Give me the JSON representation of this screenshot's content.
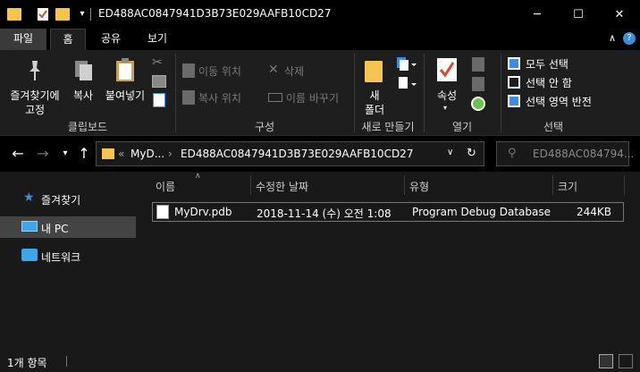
{
  "window": {
    "title": "ED488AC0847941D3B73E029AAFB10CD27",
    "controls": {
      "minimize": "─",
      "maximize": "☐",
      "close": "✕"
    }
  },
  "ribbon_tabs": [
    {
      "label": "파일"
    },
    {
      "label": "홈"
    },
    {
      "label": "공유"
    },
    {
      "label": "보기"
    }
  ],
  "ribbon": {
    "clipboard": {
      "pin_label_1": "즐겨찾기에",
      "pin_label_2": "고정",
      "copy_label": "복사",
      "paste_label": "붙여넣기",
      "group_label": "클립보드"
    },
    "organize": {
      "move_to": "이동 위치",
      "copy_to": "복사 위치",
      "delete": "삭제",
      "rename": "이름 바꾸기",
      "group_label": "구성"
    },
    "new": {
      "new_folder_1": "새",
      "new_folder_2": "폴더",
      "group_label": "새로 만들기"
    },
    "open": {
      "properties": "속성",
      "group_label": "열기"
    },
    "select": {
      "select_all": "모두 선택",
      "select_none": "선택 안 함",
      "invert_selection": "선택 영역 반전",
      "group_label": "선택"
    }
  },
  "address": {
    "breadcrumb_prefix": "«",
    "crumb_parent": "MyD...",
    "crumb_current": "ED488AC0847941D3B73E029AAFB10CD27"
  },
  "search": {
    "placeholder": "ED488AC084794..."
  },
  "nav_pane": {
    "items": [
      {
        "label": "즐겨찾기"
      },
      {
        "label": "내 PC"
      },
      {
        "label": "네트워크"
      }
    ]
  },
  "columns": {
    "name": "이름",
    "modified": "수정한 날짜",
    "type": "유형",
    "size": "크기"
  },
  "files": [
    {
      "name": "MyDrv.pdb",
      "modified": "2018-11-14 (수) 오전 1:08",
      "type": "Program Debug Database",
      "size": "244KB"
    }
  ],
  "status": {
    "item_count": "1개 항목"
  },
  "colors": {
    "folder": "#f5c451",
    "accent": "#3d8ee0"
  }
}
